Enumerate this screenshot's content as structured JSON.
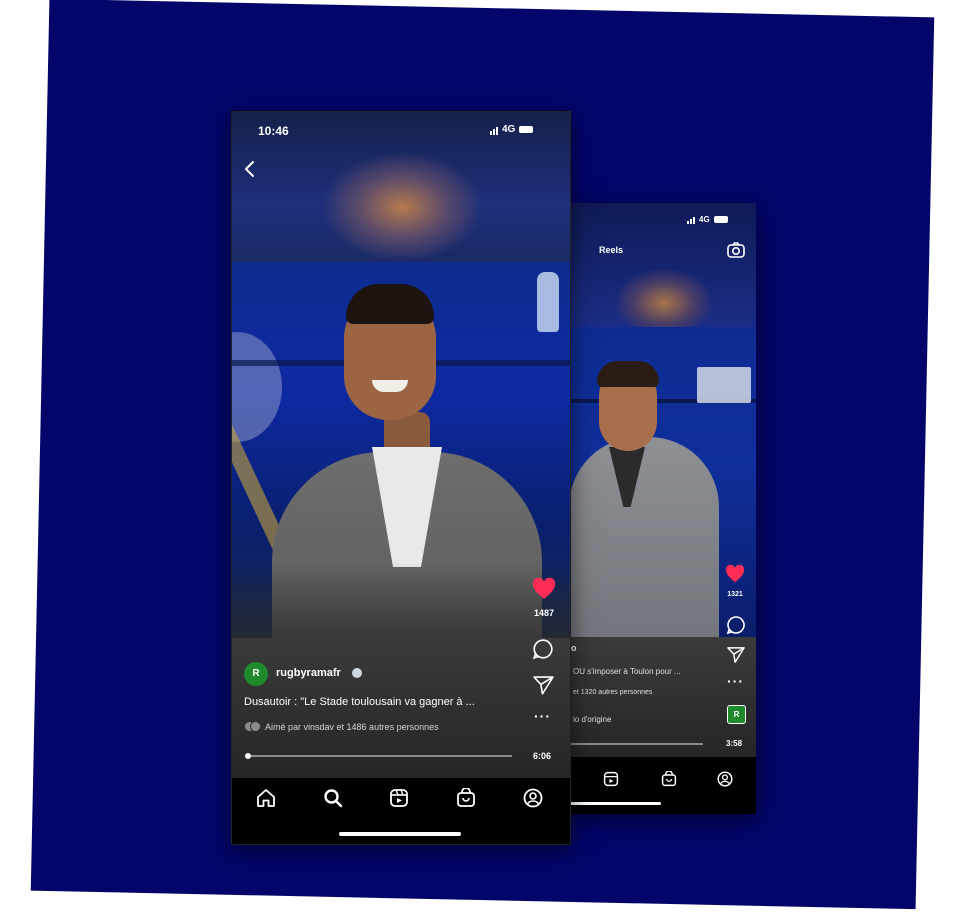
{
  "front_phone": {
    "status": {
      "time": "10:46",
      "network": "4G"
    },
    "post": {
      "username": "rugbyramafr",
      "avatar_text": "R",
      "caption": "Dusautoir : \"Le Stade toulousain va gagner à ...",
      "liked_by": "Aimé par vinsdav et 1486 autres personnes",
      "likes_count": "1487",
      "video_time": "6:06",
      "progress": 0.0
    },
    "nav": [
      "home-icon",
      "search-icon",
      "reels-icon",
      "shop-icon",
      "profile-icon"
    ]
  },
  "back_phone": {
    "status": {
      "network": "4G"
    },
    "header_title": "Reels",
    "post": {
      "caption_partial": "OU s'imposer à Toulon pour ...",
      "liked_partial": "et 1320 autres personnes",
      "audio_partial": "io d'origine",
      "likes_partial": "1321",
      "video_time": "3:58",
      "title_partial": "o",
      "badge_text": "R"
    },
    "nav": [
      "reels-icon",
      "shop-icon",
      "profile-icon"
    ]
  },
  "colors": {
    "background": "#03056a",
    "like": "#ff2d55",
    "avatar_green": "#1f8a2c"
  }
}
